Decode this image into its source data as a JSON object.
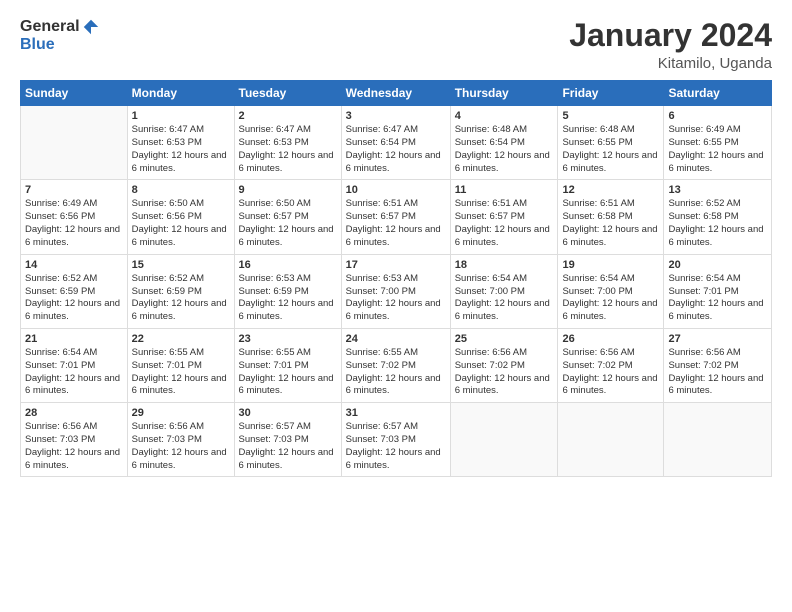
{
  "logo": {
    "general": "General",
    "blue": "Blue"
  },
  "header": {
    "title": "January 2024",
    "subtitle": "Kitamilo, Uganda"
  },
  "calendar": {
    "days": [
      "Sunday",
      "Monday",
      "Tuesday",
      "Wednesday",
      "Thursday",
      "Friday",
      "Saturday"
    ],
    "weeks": [
      [
        {
          "date": "",
          "sunrise": "",
          "sunset": "",
          "daylight": ""
        },
        {
          "date": "1",
          "sunrise": "Sunrise: 6:47 AM",
          "sunset": "Sunset: 6:53 PM",
          "daylight": "Daylight: 12 hours and 6 minutes."
        },
        {
          "date": "2",
          "sunrise": "Sunrise: 6:47 AM",
          "sunset": "Sunset: 6:53 PM",
          "daylight": "Daylight: 12 hours and 6 minutes."
        },
        {
          "date": "3",
          "sunrise": "Sunrise: 6:47 AM",
          "sunset": "Sunset: 6:54 PM",
          "daylight": "Daylight: 12 hours and 6 minutes."
        },
        {
          "date": "4",
          "sunrise": "Sunrise: 6:48 AM",
          "sunset": "Sunset: 6:54 PM",
          "daylight": "Daylight: 12 hours and 6 minutes."
        },
        {
          "date": "5",
          "sunrise": "Sunrise: 6:48 AM",
          "sunset": "Sunset: 6:55 PM",
          "daylight": "Daylight: 12 hours and 6 minutes."
        },
        {
          "date": "6",
          "sunrise": "Sunrise: 6:49 AM",
          "sunset": "Sunset: 6:55 PM",
          "daylight": "Daylight: 12 hours and 6 minutes."
        }
      ],
      [
        {
          "date": "7",
          "sunrise": "Sunrise: 6:49 AM",
          "sunset": "Sunset: 6:56 PM",
          "daylight": "Daylight: 12 hours and 6 minutes."
        },
        {
          "date": "8",
          "sunrise": "Sunrise: 6:50 AM",
          "sunset": "Sunset: 6:56 PM",
          "daylight": "Daylight: 12 hours and 6 minutes."
        },
        {
          "date": "9",
          "sunrise": "Sunrise: 6:50 AM",
          "sunset": "Sunset: 6:57 PM",
          "daylight": "Daylight: 12 hours and 6 minutes."
        },
        {
          "date": "10",
          "sunrise": "Sunrise: 6:51 AM",
          "sunset": "Sunset: 6:57 PM",
          "daylight": "Daylight: 12 hours and 6 minutes."
        },
        {
          "date": "11",
          "sunrise": "Sunrise: 6:51 AM",
          "sunset": "Sunset: 6:57 PM",
          "daylight": "Daylight: 12 hours and 6 minutes."
        },
        {
          "date": "12",
          "sunrise": "Sunrise: 6:51 AM",
          "sunset": "Sunset: 6:58 PM",
          "daylight": "Daylight: 12 hours and 6 minutes."
        },
        {
          "date": "13",
          "sunrise": "Sunrise: 6:52 AM",
          "sunset": "Sunset: 6:58 PM",
          "daylight": "Daylight: 12 hours and 6 minutes."
        }
      ],
      [
        {
          "date": "14",
          "sunrise": "Sunrise: 6:52 AM",
          "sunset": "Sunset: 6:59 PM",
          "daylight": "Daylight: 12 hours and 6 minutes."
        },
        {
          "date": "15",
          "sunrise": "Sunrise: 6:52 AM",
          "sunset": "Sunset: 6:59 PM",
          "daylight": "Daylight: 12 hours and 6 minutes."
        },
        {
          "date": "16",
          "sunrise": "Sunrise: 6:53 AM",
          "sunset": "Sunset: 6:59 PM",
          "daylight": "Daylight: 12 hours and 6 minutes."
        },
        {
          "date": "17",
          "sunrise": "Sunrise: 6:53 AM",
          "sunset": "Sunset: 7:00 PM",
          "daylight": "Daylight: 12 hours and 6 minutes."
        },
        {
          "date": "18",
          "sunrise": "Sunrise: 6:54 AM",
          "sunset": "Sunset: 7:00 PM",
          "daylight": "Daylight: 12 hours and 6 minutes."
        },
        {
          "date": "19",
          "sunrise": "Sunrise: 6:54 AM",
          "sunset": "Sunset: 7:00 PM",
          "daylight": "Daylight: 12 hours and 6 minutes."
        },
        {
          "date": "20",
          "sunrise": "Sunrise: 6:54 AM",
          "sunset": "Sunset: 7:01 PM",
          "daylight": "Daylight: 12 hours and 6 minutes."
        }
      ],
      [
        {
          "date": "21",
          "sunrise": "Sunrise: 6:54 AM",
          "sunset": "Sunset: 7:01 PM",
          "daylight": "Daylight: 12 hours and 6 minutes."
        },
        {
          "date": "22",
          "sunrise": "Sunrise: 6:55 AM",
          "sunset": "Sunset: 7:01 PM",
          "daylight": "Daylight: 12 hours and 6 minutes."
        },
        {
          "date": "23",
          "sunrise": "Sunrise: 6:55 AM",
          "sunset": "Sunset: 7:01 PM",
          "daylight": "Daylight: 12 hours and 6 minutes."
        },
        {
          "date": "24",
          "sunrise": "Sunrise: 6:55 AM",
          "sunset": "Sunset: 7:02 PM",
          "daylight": "Daylight: 12 hours and 6 minutes."
        },
        {
          "date": "25",
          "sunrise": "Sunrise: 6:56 AM",
          "sunset": "Sunset: 7:02 PM",
          "daylight": "Daylight: 12 hours and 6 minutes."
        },
        {
          "date": "26",
          "sunrise": "Sunrise: 6:56 AM",
          "sunset": "Sunset: 7:02 PM",
          "daylight": "Daylight: 12 hours and 6 minutes."
        },
        {
          "date": "27",
          "sunrise": "Sunrise: 6:56 AM",
          "sunset": "Sunset: 7:02 PM",
          "daylight": "Daylight: 12 hours and 6 minutes."
        }
      ],
      [
        {
          "date": "28",
          "sunrise": "Sunrise: 6:56 AM",
          "sunset": "Sunset: 7:03 PM",
          "daylight": "Daylight: 12 hours and 6 minutes."
        },
        {
          "date": "29",
          "sunrise": "Sunrise: 6:56 AM",
          "sunset": "Sunset: 7:03 PM",
          "daylight": "Daylight: 12 hours and 6 minutes."
        },
        {
          "date": "30",
          "sunrise": "Sunrise: 6:57 AM",
          "sunset": "Sunset: 7:03 PM",
          "daylight": "Daylight: 12 hours and 6 minutes."
        },
        {
          "date": "31",
          "sunrise": "Sunrise: 6:57 AM",
          "sunset": "Sunset: 7:03 PM",
          "daylight": "Daylight: 12 hours and 6 minutes."
        },
        {
          "date": "",
          "sunrise": "",
          "sunset": "",
          "daylight": ""
        },
        {
          "date": "",
          "sunrise": "",
          "sunset": "",
          "daylight": ""
        },
        {
          "date": "",
          "sunrise": "",
          "sunset": "",
          "daylight": ""
        }
      ]
    ]
  }
}
